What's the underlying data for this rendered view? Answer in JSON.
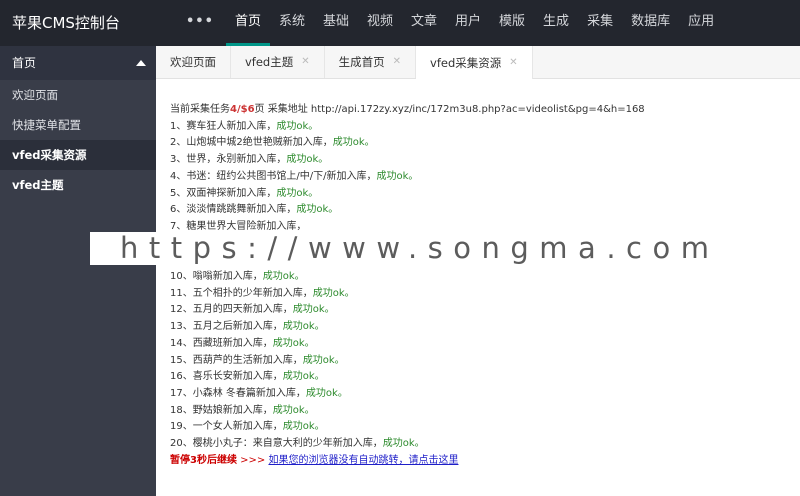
{
  "header": {
    "brand": "苹果CMS控制台",
    "more_label": "•••",
    "nav": [
      "首页",
      "系统",
      "基础",
      "视频",
      "文章",
      "用户",
      "模版",
      "生成",
      "采集",
      "数据库",
      "应用"
    ]
  },
  "sidebar": {
    "head": "首页",
    "items": [
      "欢迎页面",
      "快捷菜单配置",
      "vfed采集资源",
      "vfed主题"
    ]
  },
  "tabs": [
    {
      "label": "欢迎页面"
    },
    {
      "label": "vfed主题",
      "close": "✕"
    },
    {
      "label": "生成首页",
      "close": "✕"
    },
    {
      "label": "vfed采集资源",
      "close": "✕"
    }
  ],
  "status": {
    "prefix": "当前采集任务",
    "current": "4",
    "sep": "/",
    "total": "$6",
    "suffix": "页 采集地址 http://api.172zy.xyz/inc/172m3u8.php?ac=videolist&pg=4&h=168"
  },
  "results": [
    {
      "text": "1、赛车狂人新加入库，",
      "ok": "成功ok。"
    },
    {
      "text": "2、山炮城中城2绝世艳贼新加入库，",
      "ok": "成功ok。"
    },
    {
      "text": "3、世界，永别新加入库，",
      "ok": "成功ok。"
    },
    {
      "text": "4、书迷：纽约公共图书馆上/中/下/新加入库，",
      "ok": "成功ok。"
    },
    {
      "text": "5、双面神探新加入库，",
      "ok": "成功ok。"
    },
    {
      "text": "6、淡淡情跳跳舞新加入库，",
      "ok": "成功ok。"
    },
    {
      "text": "7、糖果世界大冒险新加入库，",
      "ok": ""
    },
    {
      "text": "",
      "ok": ""
    },
    {
      "text": "",
      "ok": ""
    },
    {
      "text": "10、嗡嗡新加入库，",
      "ok": "成功ok。"
    },
    {
      "text": "11、五个相扑的少年新加入库，",
      "ok": "成功ok。"
    },
    {
      "text": "12、五月的四天新加入库，",
      "ok": "成功ok。"
    },
    {
      "text": "13、五月之后新加入库，",
      "ok": "成功ok。"
    },
    {
      "text": "14、西藏班新加入库，",
      "ok": "成功ok。"
    },
    {
      "text": "15、西葫芦的生活新加入库，",
      "ok": "成功ok。"
    },
    {
      "text": "16、喜乐长安新加入库，",
      "ok": "成功ok。"
    },
    {
      "text": "17、小森林 冬春篇新加入库，",
      "ok": "成功ok。"
    },
    {
      "text": "18、野姑娘新加入库，",
      "ok": "成功ok。"
    },
    {
      "text": "19、一个女人新加入库，",
      "ok": "成功ok。"
    },
    {
      "text": "20、樱桃小丸子：来自意大利的少年新加入库，",
      "ok": "成功ok。"
    }
  ],
  "footer": {
    "wait": "暂停3秒后继续",
    "arrows": " >>> ",
    "link": "如果您的浏览器没有自动跳转，请点击这里"
  },
  "watermark": "https://www.songma.com"
}
